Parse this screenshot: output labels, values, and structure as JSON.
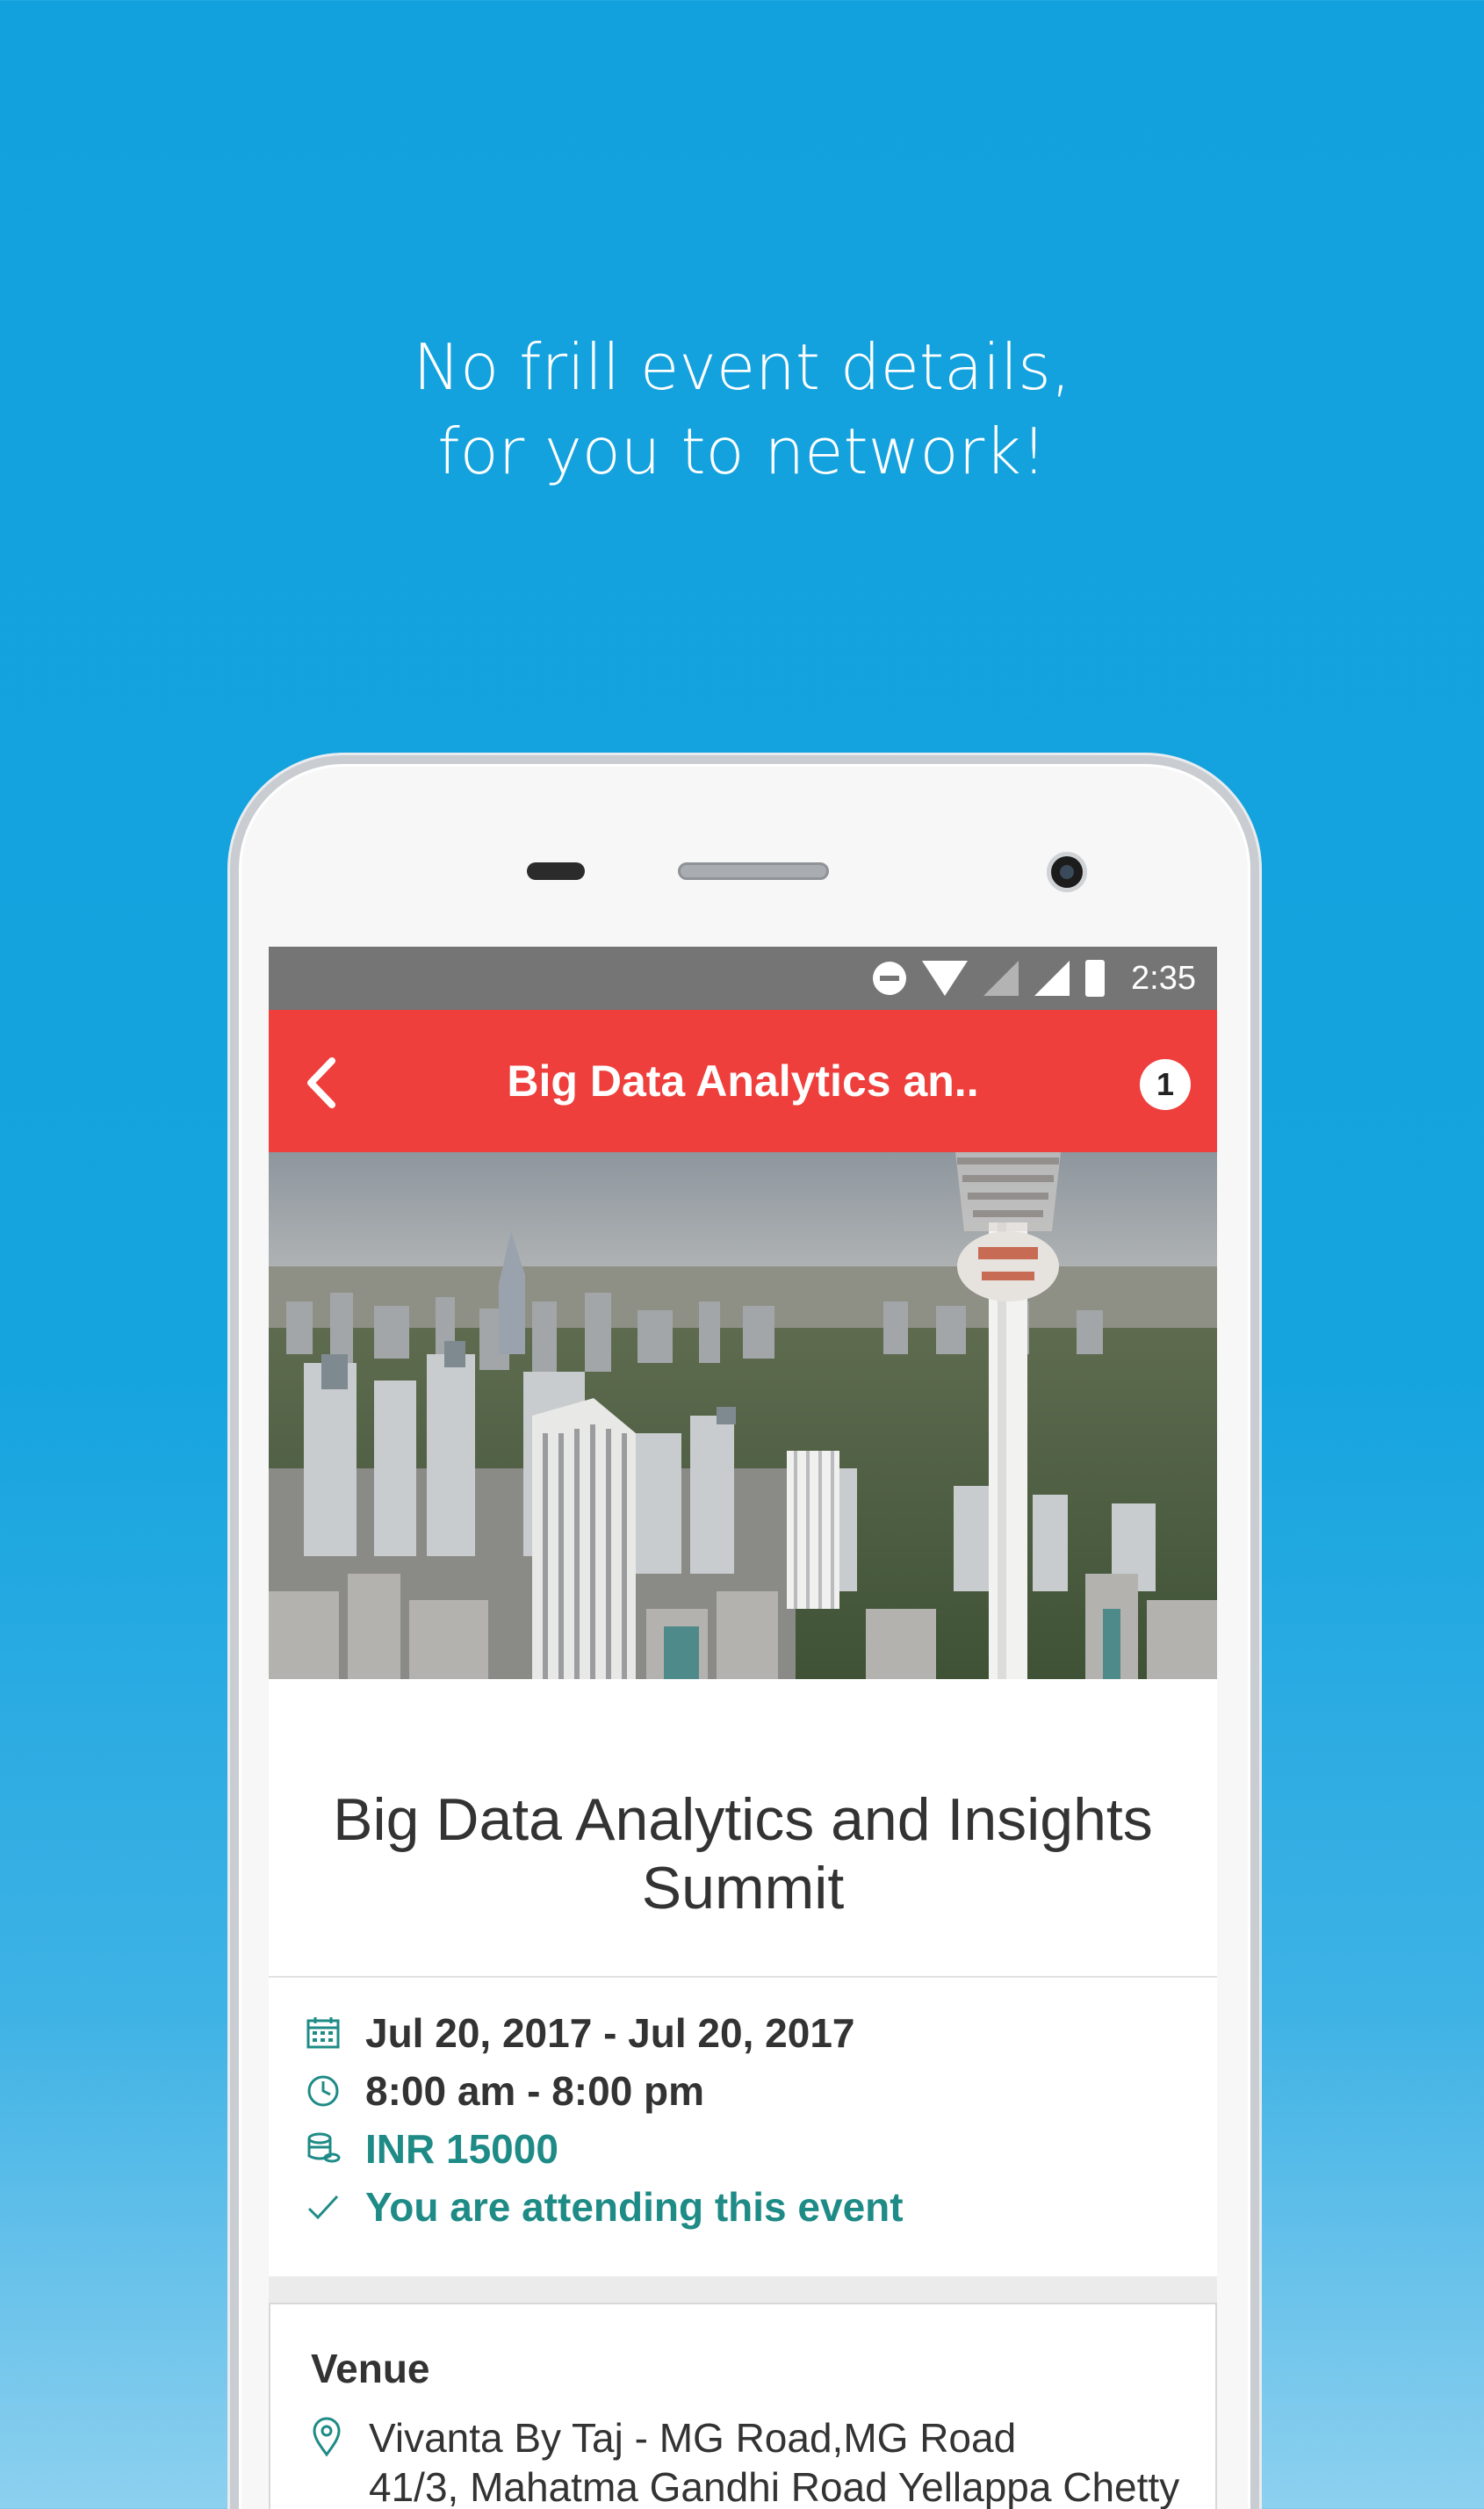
{
  "headline": {
    "line1": "No frill event details,",
    "line2": "for you to network!"
  },
  "status_bar": {
    "time": "2:35"
  },
  "app_bar": {
    "title": "Big Data Analytics an..",
    "notification_count": "1"
  },
  "event": {
    "title": "Big Data Analytics and Insights Summit",
    "date_range": "Jul 20, 2017 - Jul 20, 2017",
    "time_range": "8:00 am - 8:00 pm",
    "price": "INR 15000",
    "attendance_status": "You are attending this event"
  },
  "venue": {
    "heading": "Venue",
    "line1": "Vivanta By Taj - MG Road,MG Road",
    "line2": "41/3, Mahatma Gandhi Road Yellappa Chetty"
  },
  "colors": {
    "background": "#12a1dd",
    "app_bar": "#ee3f3c",
    "status_bar": "#757575",
    "accent_teal": "#1f8b86"
  }
}
